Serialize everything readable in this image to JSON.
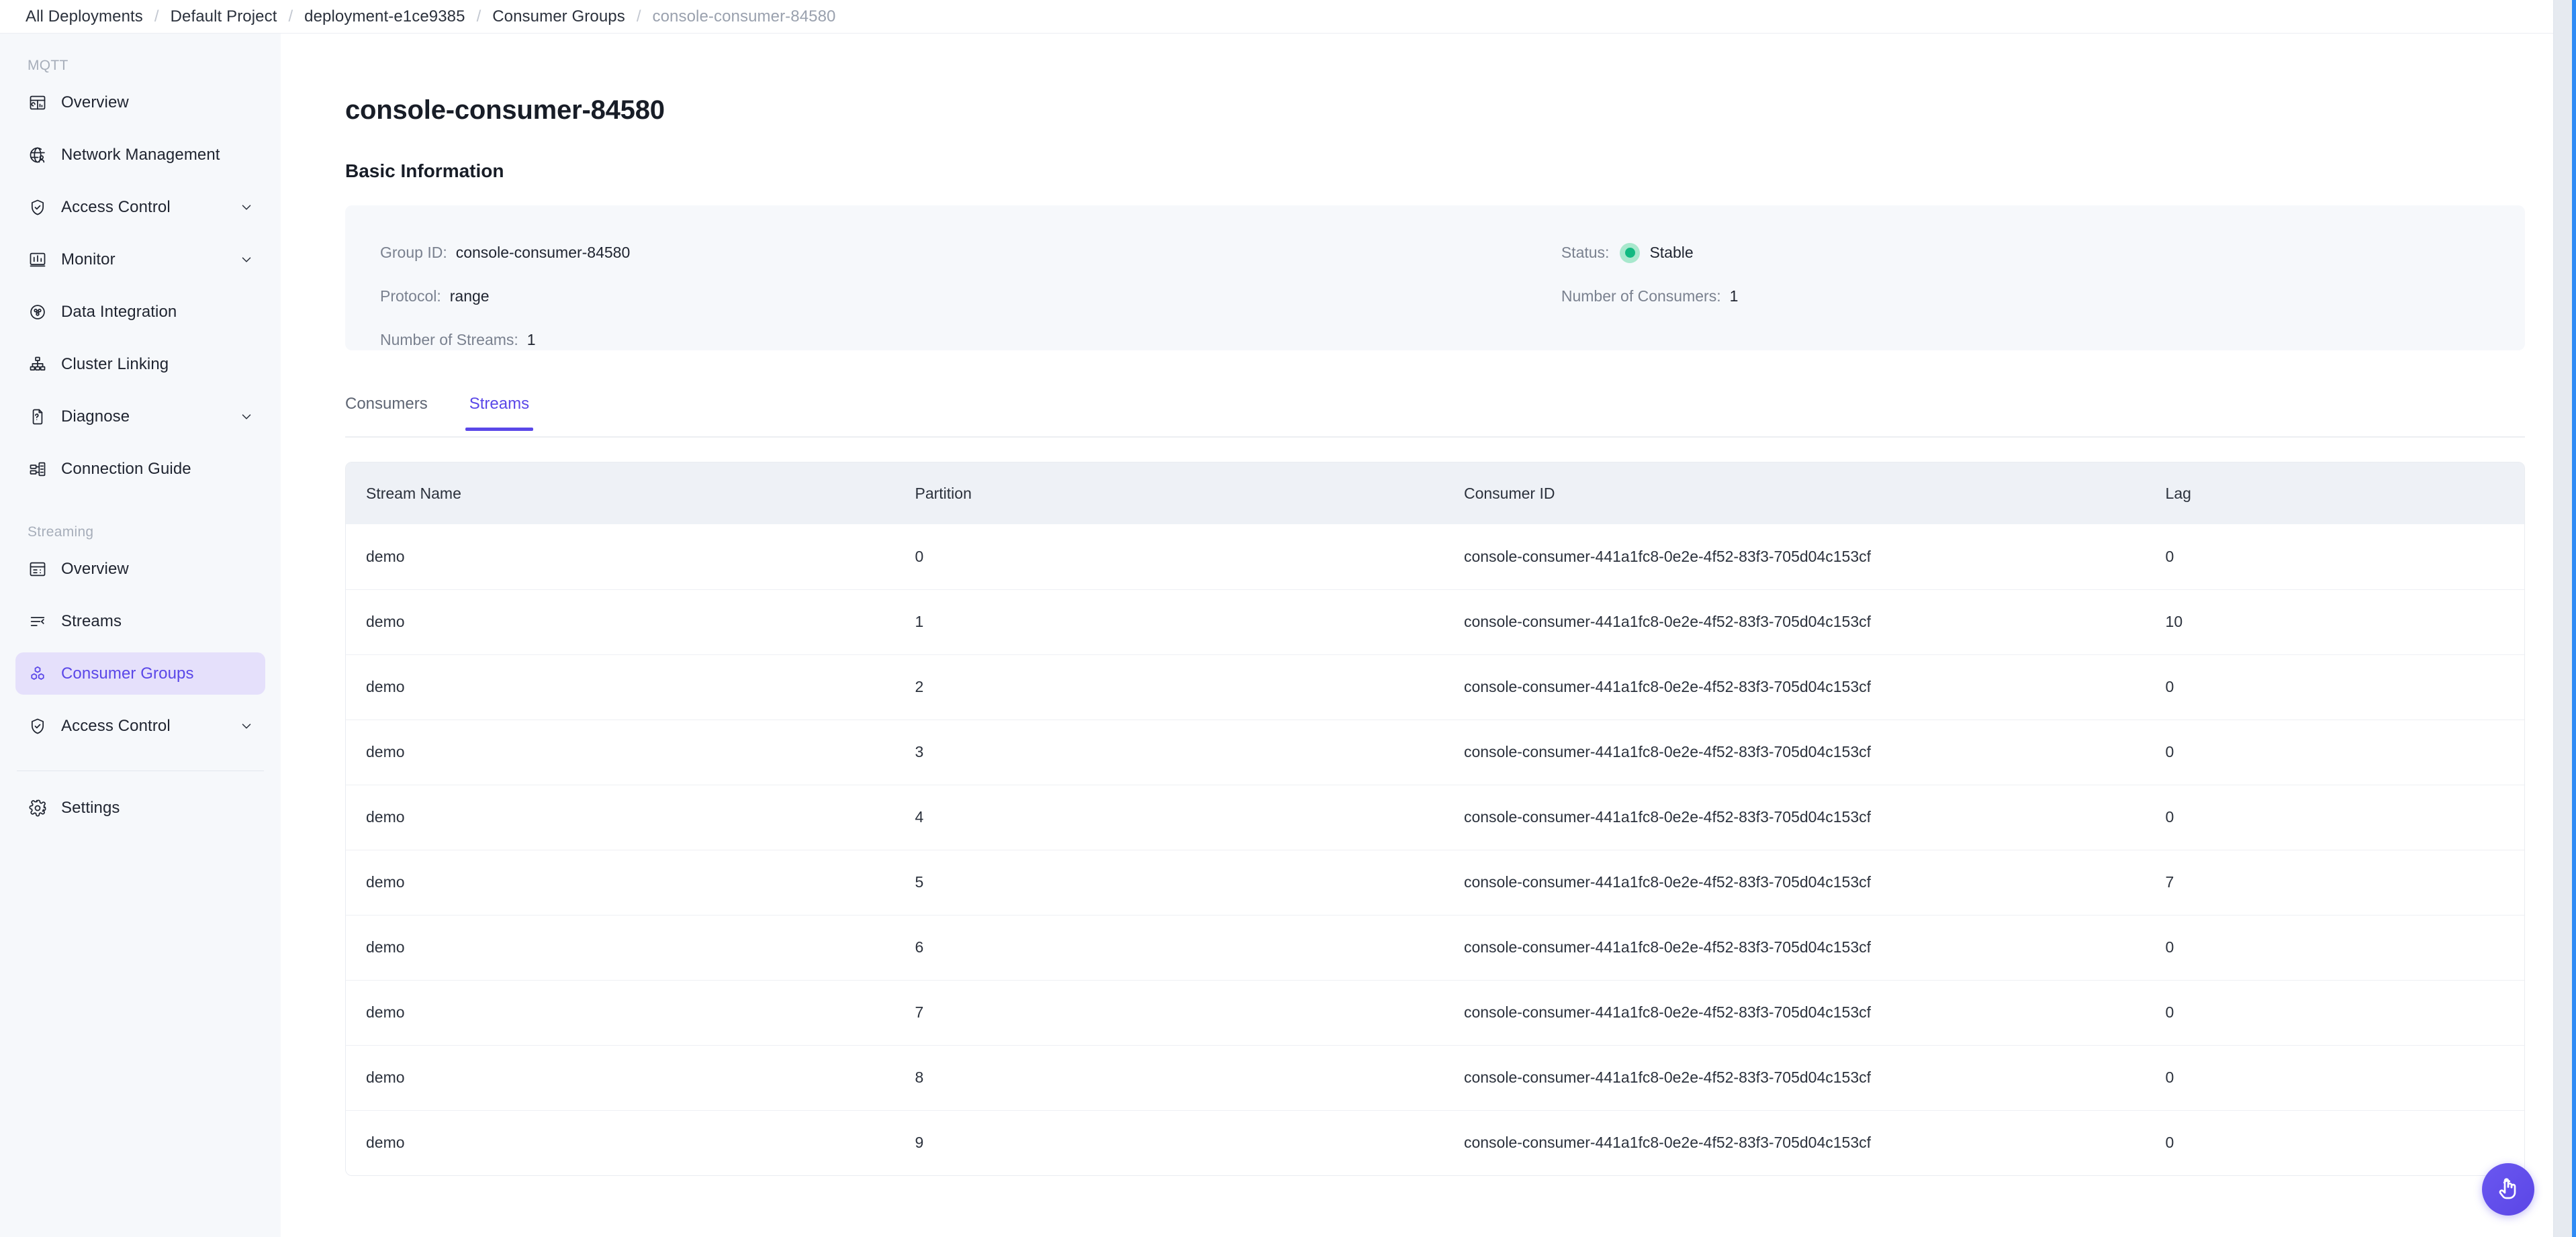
{
  "breadcrumb": {
    "items": [
      {
        "label": "All Deployments",
        "muted": false
      },
      {
        "label": "Default Project",
        "muted": false
      },
      {
        "label": "deployment-e1ce9385",
        "muted": false
      },
      {
        "label": "Consumer Groups",
        "muted": false
      },
      {
        "label": "console-consumer-84580",
        "muted": true
      }
    ],
    "separator": "/"
  },
  "sidebar": {
    "groups": [
      {
        "label": "MQTT",
        "items": [
          {
            "label": "Overview",
            "icon": "dashboard-icon",
            "expandable": false,
            "active": false
          },
          {
            "label": "Network Management",
            "icon": "globe-user-icon",
            "expandable": false,
            "active": false
          },
          {
            "label": "Access Control",
            "icon": "shield-check-icon",
            "expandable": true,
            "active": false
          },
          {
            "label": "Monitor",
            "icon": "bar-chart-icon",
            "expandable": true,
            "active": false
          },
          {
            "label": "Data Integration",
            "icon": "data-flow-icon",
            "expandable": false,
            "active": false
          },
          {
            "label": "Cluster Linking",
            "icon": "sitemap-icon",
            "expandable": false,
            "active": false
          },
          {
            "label": "Diagnose",
            "icon": "file-question-icon",
            "expandable": true,
            "active": false
          },
          {
            "label": "Connection Guide",
            "icon": "connection-icon",
            "expandable": false,
            "active": false
          }
        ]
      },
      {
        "label": "Streaming",
        "items": [
          {
            "label": "Overview",
            "icon": "layout-icon",
            "expandable": false,
            "active": false
          },
          {
            "label": "Streams",
            "icon": "stream-lines-icon",
            "expandable": false,
            "active": false
          },
          {
            "label": "Consumer Groups",
            "icon": "cubes-icon",
            "expandable": false,
            "active": true
          },
          {
            "label": "Access Control",
            "icon": "shield-check-icon",
            "expandable": true,
            "active": false
          }
        ]
      }
    ],
    "footer": [
      {
        "label": "Settings",
        "icon": "gear-icon",
        "expandable": false,
        "active": false
      }
    ]
  },
  "page": {
    "title": "console-consumer-84580",
    "section_title": "Basic Information"
  },
  "basic_info": {
    "left": [
      {
        "key": "Group ID:",
        "value": "console-consumer-84580"
      },
      {
        "key": "Protocol:",
        "value": "range"
      },
      {
        "key": "Number of Streams:",
        "value": "1"
      }
    ],
    "right": [
      {
        "key": "Status:",
        "value": "Stable",
        "has_dot": true,
        "dot_color": "#12b981"
      },
      {
        "key": "Number of Consumers:",
        "value": "1",
        "has_dot": false
      }
    ]
  },
  "tabs": [
    {
      "label": "Consumers",
      "active": false
    },
    {
      "label": "Streams",
      "active": true
    }
  ],
  "table": {
    "columns": [
      "Stream Name",
      "Partition",
      "Consumer ID",
      "Lag"
    ],
    "rows": [
      {
        "stream": "demo",
        "partition": "0",
        "consumer_id": "console-consumer-441a1fc8-0e2e-4f52-83f3-705d04c153cf",
        "lag": "0"
      },
      {
        "stream": "demo",
        "partition": "1",
        "consumer_id": "console-consumer-441a1fc8-0e2e-4f52-83f3-705d04c153cf",
        "lag": "10"
      },
      {
        "stream": "demo",
        "partition": "2",
        "consumer_id": "console-consumer-441a1fc8-0e2e-4f52-83f3-705d04c153cf",
        "lag": "0"
      },
      {
        "stream": "demo",
        "partition": "3",
        "consumer_id": "console-consumer-441a1fc8-0e2e-4f52-83f3-705d04c153cf",
        "lag": "0"
      },
      {
        "stream": "demo",
        "partition": "4",
        "consumer_id": "console-consumer-441a1fc8-0e2e-4f52-83f3-705d04c153cf",
        "lag": "0"
      },
      {
        "stream": "demo",
        "partition": "5",
        "consumer_id": "console-consumer-441a1fc8-0e2e-4f52-83f3-705d04c153cf",
        "lag": "7"
      },
      {
        "stream": "demo",
        "partition": "6",
        "consumer_id": "console-consumer-441a1fc8-0e2e-4f52-83f3-705d04c153cf",
        "lag": "0"
      },
      {
        "stream": "demo",
        "partition": "7",
        "consumer_id": "console-consumer-441a1fc8-0e2e-4f52-83f3-705d04c153cf",
        "lag": "0"
      },
      {
        "stream": "demo",
        "partition": "8",
        "consumer_id": "console-consumer-441a1fc8-0e2e-4f52-83f3-705d04c153cf",
        "lag": "0"
      },
      {
        "stream": "demo",
        "partition": "9",
        "consumer_id": "console-consumer-441a1fc8-0e2e-4f52-83f3-705d04c153cf",
        "lag": "0"
      }
    ]
  },
  "fab": {
    "icon": "pointing-hand-icon",
    "color": "#5b46e6"
  },
  "colors": {
    "accent": "#5a47e8",
    "accent_bg": "#e5e0fb",
    "status_green": "#12b981",
    "sidebar_bg": "#f6f8fb",
    "card_bg": "#f6f8fb",
    "table_header_bg": "#eef1f6"
  }
}
